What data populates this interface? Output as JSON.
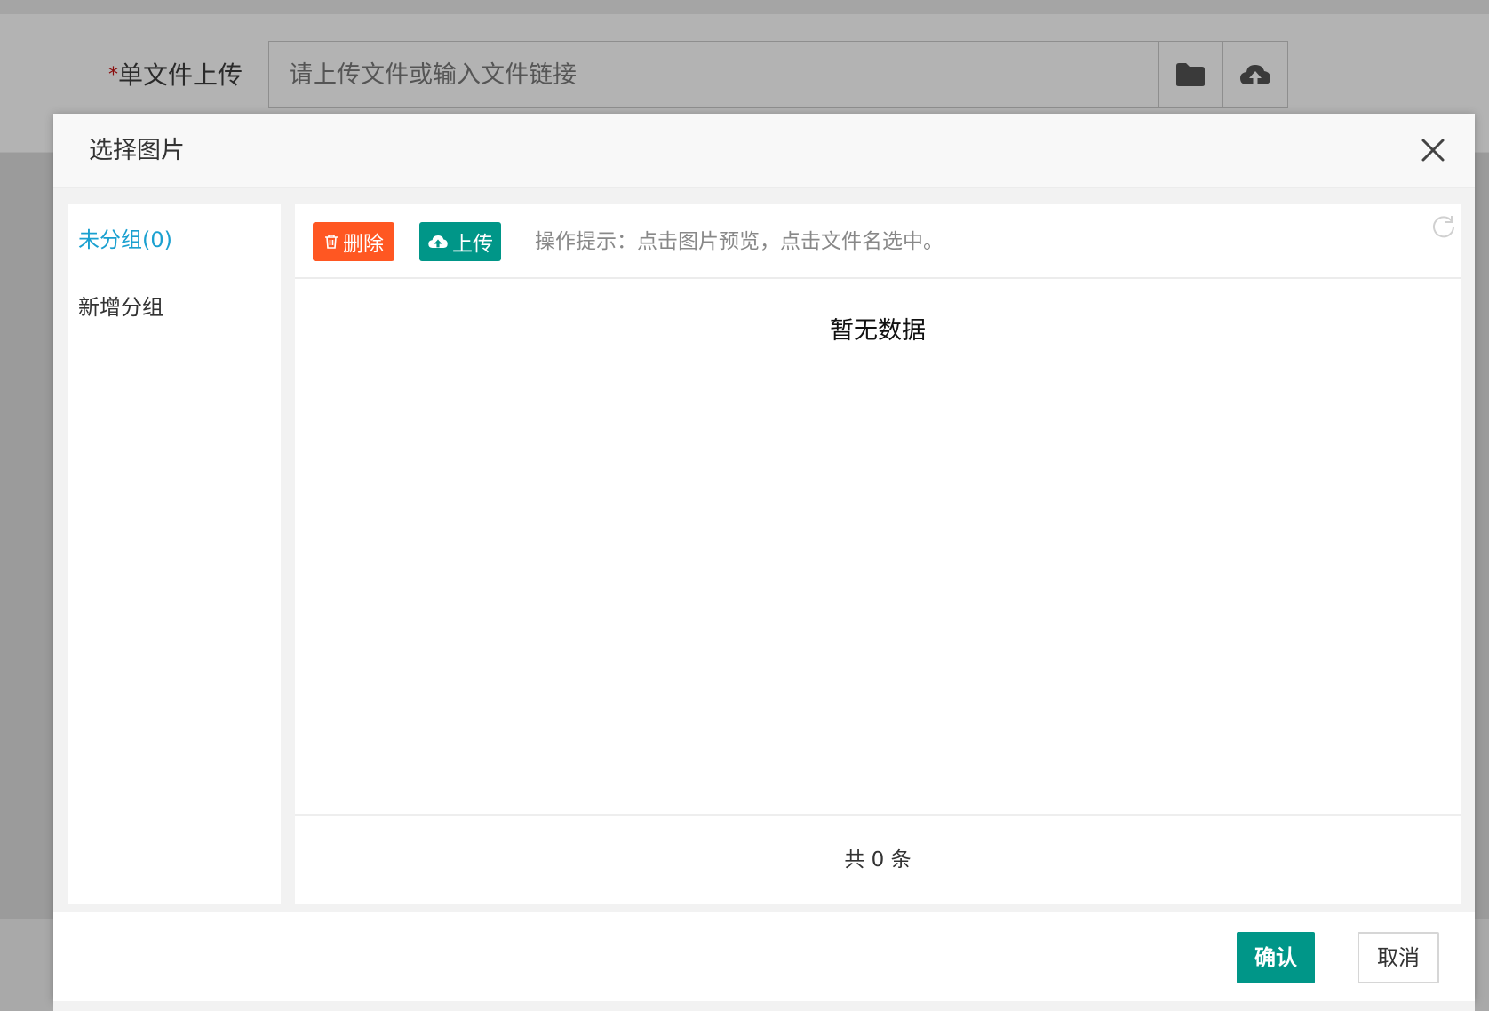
{
  "background_form": {
    "required_mark": "*",
    "label": "单文件上传",
    "input_placeholder": "请上传文件或输入文件链接",
    "buttons": [
      {
        "icon": "folder-icon"
      },
      {
        "icon": "cloud-upload-icon"
      }
    ]
  },
  "modal": {
    "title": "选择图片",
    "close_icon": "close-icon",
    "sidebar": {
      "items": [
        {
          "label": "未分组(0)",
          "active": true
        },
        {
          "label": "新增分组",
          "active": false
        }
      ]
    },
    "toolbar": {
      "delete_label": "删除",
      "delete_icon": "trash-icon",
      "upload_label": "上传",
      "upload_icon": "cloud-upload-icon",
      "tip": "操作提示：点击图片预览，点击文件名选中。",
      "refresh_icon": "refresh-icon"
    },
    "empty_text": "暂无数据",
    "total_text": "共 0 条",
    "footer": {
      "confirm_label": "确认",
      "cancel_label": "取消"
    }
  },
  "colors": {
    "active_link": "#1aa0d0",
    "delete_button": "#ff5722",
    "primary_button": "#009688"
  }
}
